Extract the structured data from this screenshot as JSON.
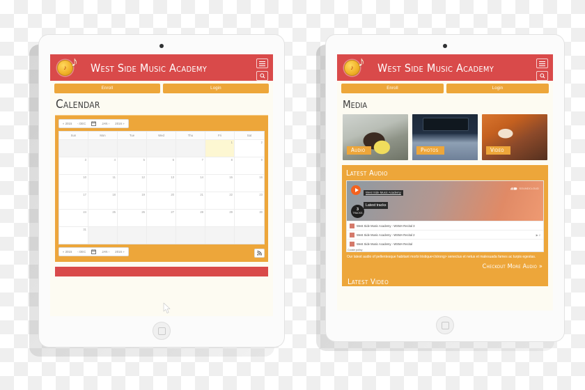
{
  "site": {
    "title": "West Side Music Academy",
    "logo_icon": "music-note-badge-icon",
    "menu_icon": "hamburger-menu-icon",
    "search_icon": "search-icon",
    "enroll_label": "Enroll",
    "login_label": "Login"
  },
  "left_device": {
    "page_title": "Calendar",
    "calendar": {
      "nav": {
        "prev_year": "« 2015",
        "prev_month": "‹ DEC",
        "today_icon": "calendar-icon",
        "next_month": "JAN ›",
        "next_year": "2016 »"
      },
      "weekdays": [
        "Sun",
        "Mon",
        "Tue",
        "Wed",
        "Thu",
        "Fri",
        "Sat"
      ],
      "month": "JAN",
      "year": "2016",
      "today": 1,
      "days": [
        {
          "n": "",
          "off": true
        },
        {
          "n": "",
          "off": true
        },
        {
          "n": "",
          "off": true
        },
        {
          "n": "",
          "off": true
        },
        {
          "n": "",
          "off": true
        },
        {
          "n": "1",
          "today": true
        },
        {
          "n": "2"
        },
        {
          "n": "3"
        },
        {
          "n": "4"
        },
        {
          "n": "5"
        },
        {
          "n": "6"
        },
        {
          "n": "7"
        },
        {
          "n": "8"
        },
        {
          "n": "9"
        },
        {
          "n": "10"
        },
        {
          "n": "11"
        },
        {
          "n": "12"
        },
        {
          "n": "13"
        },
        {
          "n": "14"
        },
        {
          "n": "15"
        },
        {
          "n": "16"
        },
        {
          "n": "17"
        },
        {
          "n": "18"
        },
        {
          "n": "19"
        },
        {
          "n": "20"
        },
        {
          "n": "21"
        },
        {
          "n": "22"
        },
        {
          "n": "23"
        },
        {
          "n": "24"
        },
        {
          "n": "25"
        },
        {
          "n": "26"
        },
        {
          "n": "27"
        },
        {
          "n": "28"
        },
        {
          "n": "29"
        },
        {
          "n": "30"
        },
        {
          "n": "31"
        },
        {
          "n": "",
          "off": true
        },
        {
          "n": "",
          "off": true
        },
        {
          "n": "",
          "off": true
        },
        {
          "n": "",
          "off": true
        },
        {
          "n": "",
          "off": true
        },
        {
          "n": "",
          "off": true
        }
      ],
      "rss_icon": "rss-feed-icon"
    }
  },
  "right_device": {
    "page_title": "Media",
    "media_cards": [
      {
        "label": "Audio",
        "image": "girl-playing-violin-photo"
      },
      {
        "label": "Photos",
        "image": "live-music-band-photo"
      },
      {
        "label": "Video",
        "image": "man-playing-guitar-photo"
      }
    ],
    "latest_audio": {
      "heading": "Latest Audio",
      "player": {
        "play_icon": "play-button-icon",
        "artist": "West Side Music Academy",
        "track_title": "Latest tracks",
        "brand": "SOUNDCLOUD",
        "brand_icon": "soundcloud-cloud-icon",
        "badge_count": "3",
        "badge_label": "TRACKS"
      },
      "tracks": [
        {
          "name": "West Side Music Academy - WSMA Recital 3",
          "plays": ""
        },
        {
          "name": "West Side Music Academy - WSMA Recital 2",
          "plays": "2"
        },
        {
          "name": "West Side Music Academy - WSMA Recital",
          "plays": ""
        }
      ],
      "cookie_policy": "Cookie policy",
      "description": "Our latest audio of pellentesque habitant morbi tristique</strong> senectus et netus et malesuada fames ac turpis egestas.",
      "more_link": "Checkout More Audio »"
    },
    "latest_video": {
      "heading": "Latest Video"
    }
  },
  "colors": {
    "header_red": "#d94a4a",
    "accent_orange": "#eda63a",
    "page_cream": "#fdfbf2",
    "today_highlight": "#fdf7d2"
  },
  "cursor": {
    "icon": "mouse-pointer-icon"
  }
}
